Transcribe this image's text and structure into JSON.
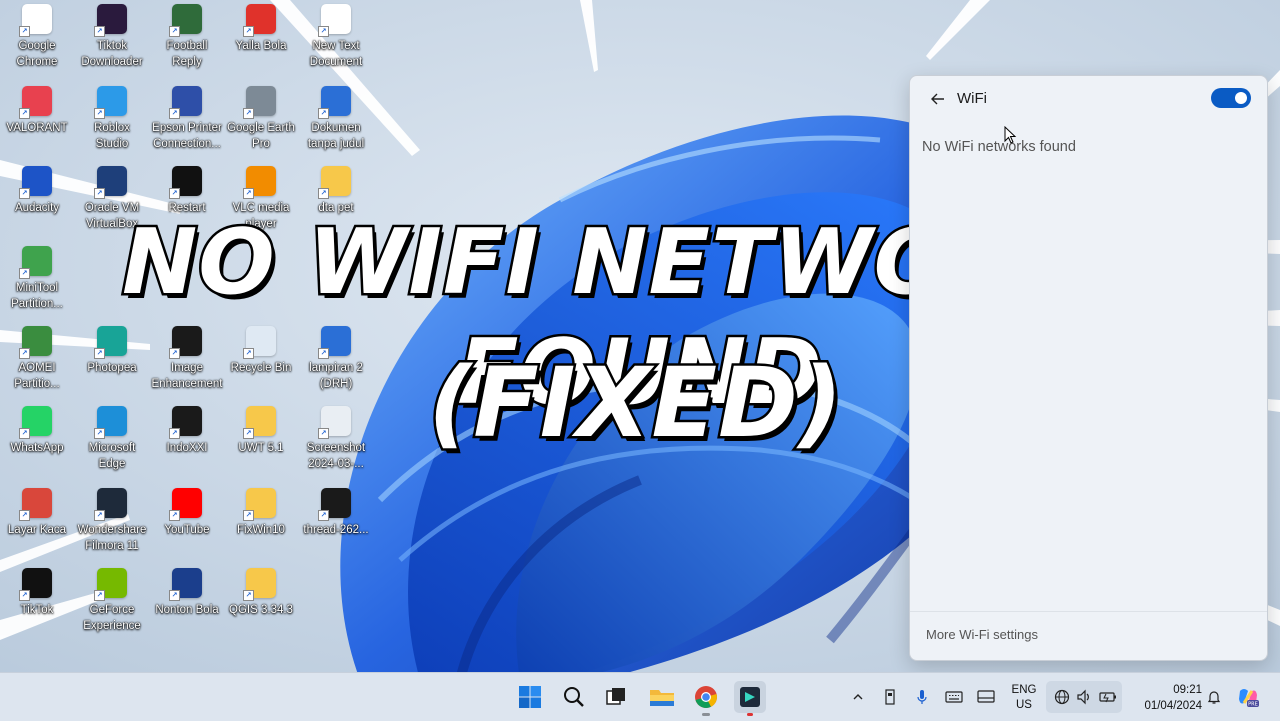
{
  "desktop_icons": [
    {
      "label": "Google\nChrome",
      "icon": "chrome-icon",
      "color": "#ffffff"
    },
    {
      "label": "Tiktok\nDownloader",
      "icon": "tiktok-downloader-icon",
      "color": "#2a1a3d"
    },
    {
      "label": "Football\nReply",
      "icon": "football-icon",
      "color": "#2f6b3a"
    },
    {
      "label": "Yalla Bola",
      "icon": "play-icon",
      "color": "#e0322b"
    },
    {
      "label": "New Text\nDocument",
      "icon": "text-document-icon",
      "color": "#ffffff"
    },
    {
      "label": "VALORANT",
      "icon": "valorant-icon",
      "color": "#e8414f"
    },
    {
      "label": "Roblox\nStudio",
      "icon": "roblox-studio-icon",
      "color": "#2c9ae8"
    },
    {
      "label": "Epson Printer\nConnection...",
      "icon": "epson-printer-icon",
      "color": "#2e4fa8"
    },
    {
      "label": "Google Earth\nPro",
      "icon": "google-earth-icon",
      "color": "#7d8a96"
    },
    {
      "label": "Dokumen\ntanpa judul",
      "icon": "word-document-icon",
      "color": "#2b6fd6"
    },
    {
      "label": "Audacity",
      "icon": "audacity-icon",
      "color": "#1d54c7"
    },
    {
      "label": "Oracle VM\nVirtualBox",
      "icon": "virtualbox-icon",
      "color": "#1e3f7a"
    },
    {
      "label": "Restart",
      "icon": "terminal-icon",
      "color": "#111111"
    },
    {
      "label": "VLC media\nplayer",
      "icon": "vlc-icon",
      "color": "#f28c00"
    },
    {
      "label": "dta pet",
      "icon": "folder-icon",
      "color": "#f7c84a"
    },
    {
      "label": "MiniTool\nPartition...",
      "icon": "minitool-icon",
      "color": "#3fa34d"
    },
    {
      "label": "AOMEI\nPartitio...",
      "icon": "aomei-icon",
      "color": "#3a8d3f"
    },
    {
      "label": "Photopea",
      "icon": "photopea-icon",
      "color": "#18a497"
    },
    {
      "label": "Image\nEnhancement",
      "icon": "image-enhancement-icon",
      "color": "#1a1a1a"
    },
    {
      "label": "Recycle Bin",
      "icon": "recycle-bin-icon",
      "color": "#dfe9f3"
    },
    {
      "label": "lampiran 2\n(DRH)",
      "icon": "word-document-icon",
      "color": "#2b6fd6"
    },
    {
      "label": "WhatsApp",
      "icon": "whatsapp-icon",
      "color": "#25d366"
    },
    {
      "label": "Microsoft\nEdge",
      "icon": "edge-icon",
      "color": "#1d8fd8"
    },
    {
      "label": "IndoXXI",
      "icon": "indoxxi-icon",
      "color": "#1a1a1a"
    },
    {
      "label": "UWT 5.1",
      "icon": "folder-icon",
      "color": "#f7c84a"
    },
    {
      "label": "Screenshot\n2024-03-...",
      "icon": "screenshot-file-icon",
      "color": "#e9eef3"
    },
    {
      "label": "Layar Kaca",
      "icon": "layar-kaca-icon",
      "color": "#d9473b"
    },
    {
      "label": "Wondershare\nFilmora 11",
      "icon": "filmora-icon",
      "color": "#1e2a3a"
    },
    {
      "label": "YouTube",
      "icon": "youtube-icon",
      "color": "#ff0000"
    },
    {
      "label": "FixWin10",
      "icon": "folder-icon",
      "color": "#f7c84a"
    },
    {
      "label": "thread-262...",
      "icon": "thread-file-icon",
      "color": "#1a1a1a"
    },
    {
      "label": "TikTok",
      "icon": "tiktok-icon",
      "color": "#111111"
    },
    {
      "label": "GeForce\nExperience",
      "icon": "geforce-icon",
      "color": "#76b900"
    },
    {
      "label": "Nonton Bola",
      "icon": "live-icon",
      "color": "#1b3e8c"
    },
    {
      "label": "QGIS 3.34.3",
      "icon": "folder-icon",
      "color": "#f7c84a"
    }
  ],
  "overlay": {
    "line1": "NO WIFI NETWORKS FOUND",
    "line2": "(FIXED)"
  },
  "wifi_panel": {
    "title": "WiFi",
    "toggle_on": true,
    "toggle_color": "#0a5bc4",
    "empty_message": "No WiFi networks found",
    "settings_link": "More Wi-Fi settings"
  },
  "taskbar": {
    "apps": [
      "start-icon",
      "search-icon",
      "task-view-icon",
      "file-explorer-icon",
      "chrome-icon",
      "filmora-icon"
    ],
    "tray": {
      "language_top": "ENG",
      "language_bottom": "US",
      "time": "09:21",
      "date": "01/04/2024"
    }
  }
}
